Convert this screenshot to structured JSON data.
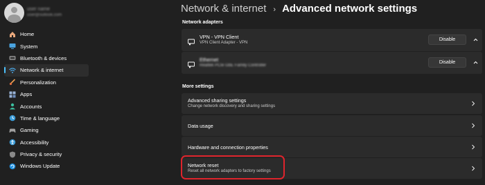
{
  "profile": {
    "name": "user name",
    "email": "user@outlook.com"
  },
  "sidebar": {
    "items": [
      {
        "label": "Home",
        "icon": "home-icon",
        "active": false
      },
      {
        "label": "System",
        "icon": "monitor-icon",
        "active": false
      },
      {
        "label": "Bluetooth & devices",
        "icon": "bluetooth-icon",
        "active": false
      },
      {
        "label": "Network & internet",
        "icon": "wifi-icon",
        "active": true
      },
      {
        "label": "Personalization",
        "icon": "brush-icon",
        "active": false
      },
      {
        "label": "Apps",
        "icon": "apps-icon",
        "active": false
      },
      {
        "label": "Accounts",
        "icon": "person-icon",
        "active": false
      },
      {
        "label": "Time & language",
        "icon": "globe-clock-icon",
        "active": false
      },
      {
        "label": "Gaming",
        "icon": "controller-icon",
        "active": false
      },
      {
        "label": "Accessibility",
        "icon": "accessibility-icon",
        "active": false
      },
      {
        "label": "Privacy & security",
        "icon": "shield-icon",
        "active": false
      },
      {
        "label": "Windows Update",
        "icon": "update-icon",
        "active": false
      }
    ]
  },
  "header": {
    "parent": "Network & internet",
    "separator": "›",
    "current": "Advanced network settings"
  },
  "adapters": {
    "section_title": "Network adapters",
    "items": [
      {
        "name": "VPN - VPN Client",
        "description": "VPN Client Adapter - VPN",
        "button": "Disable"
      },
      {
        "name": "Ethernet",
        "description": "Realtek PCIe GbE Family Controller",
        "button": "Disable"
      }
    ]
  },
  "more_settings": {
    "section_title": "More settings",
    "items": [
      {
        "title": "Advanced sharing settings",
        "subtitle": "Change network discovery and sharing settings"
      },
      {
        "title": "Data usage"
      },
      {
        "title": "Hardware and connection properties"
      },
      {
        "title": "Network reset",
        "subtitle": "Reset all network adapters to factory settings"
      }
    ]
  },
  "colors": {
    "accent": "#4cc2ff",
    "highlight_ring": "#e0242c",
    "background": "#202020",
    "card": "#2b2b2b"
  }
}
